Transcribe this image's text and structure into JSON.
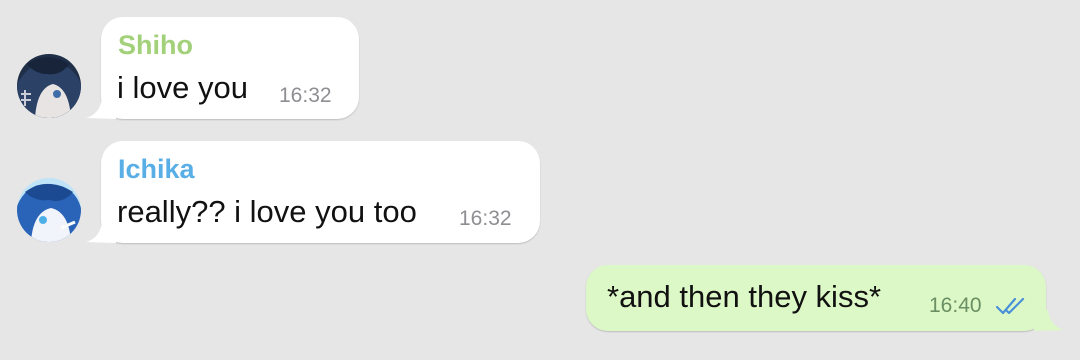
{
  "chat": {
    "background": "#e6e6e6",
    "messages": [
      {
        "sender": "Shiho",
        "sender_color": "#a3d17a",
        "text": "i love you",
        "time": "16:32",
        "avatar_icon": "shiho-avatar-icon",
        "direction": "incoming"
      },
      {
        "sender": "Ichika",
        "sender_color": "#5aaee6",
        "text": "really?? i love you too",
        "time": "16:32",
        "avatar_icon": "ichika-avatar-icon",
        "direction": "incoming"
      },
      {
        "sender": "",
        "text": "*and then they kiss*",
        "time": "16:40",
        "status_icon": "double-check-icon",
        "status": "read",
        "status_color": "#4a90d9",
        "bubble_color": "#dcf8c6",
        "direction": "outgoing"
      }
    ]
  }
}
